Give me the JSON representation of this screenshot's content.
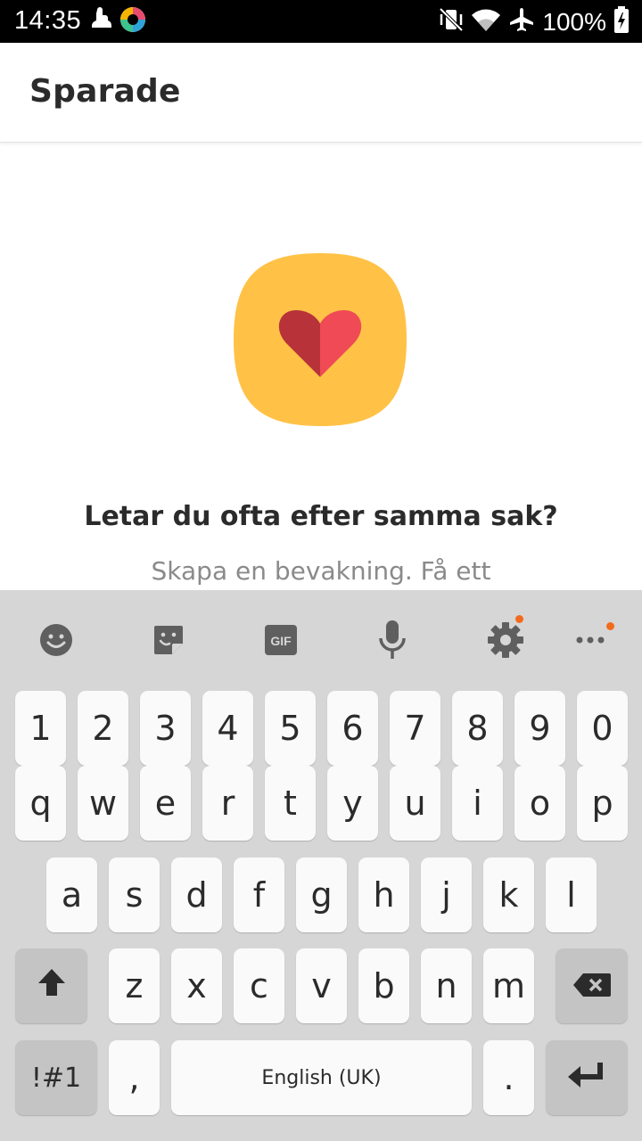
{
  "status_bar": {
    "time": "14:35",
    "battery_text": "100%",
    "icons": [
      "hand-icon",
      "app-badge-icon",
      "vibrate-mute-icon",
      "wifi-icon",
      "airplane-icon",
      "battery-charging-icon"
    ]
  },
  "app_bar": {
    "title": "Sparade"
  },
  "empty_state": {
    "illustration": "heart-icon",
    "title": "Letar du ofta efter samma sak?",
    "body": "Skapa en bevakning. Få ett"
  },
  "keyboard": {
    "toolbar": [
      "emoji-icon",
      "sticker-icon",
      "gif-icon",
      "microphone-icon",
      "settings-icon",
      "more-icon"
    ],
    "gif_label": "GIF",
    "row_numbers": [
      "1",
      "2",
      "3",
      "4",
      "5",
      "6",
      "7",
      "8",
      "9",
      "0"
    ],
    "row_top": [
      "q",
      "w",
      "e",
      "r",
      "t",
      "y",
      "u",
      "i",
      "o",
      "p"
    ],
    "row_middle": [
      "a",
      "s",
      "d",
      "f",
      "g",
      "h",
      "j",
      "k",
      "l"
    ],
    "row_bottom": [
      "z",
      "x",
      "c",
      "v",
      "b",
      "n",
      "m"
    ],
    "symbols_label": "!#1",
    "comma_label": ",",
    "space_label": "English (UK)",
    "period_label": ".",
    "colors": {
      "background": "#d6d6d6",
      "key": "#fafafa",
      "function_key": "#c4c4c4",
      "notification_dot": "#f26b1d"
    }
  },
  "colors": {
    "illustration_bg": "#ffc247",
    "heart_left": "#b8323a",
    "heart_right": "#ef4a55"
  }
}
